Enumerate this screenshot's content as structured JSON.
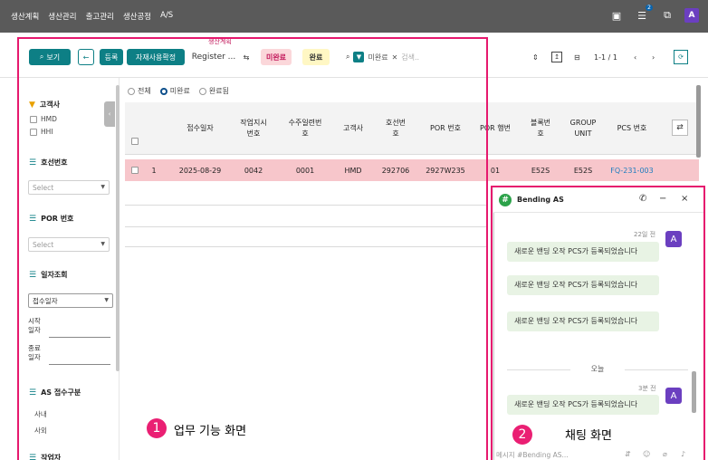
{
  "topbar": {
    "nav": [
      "생산계획",
      "생산관리",
      "출고관리",
      "생산공정",
      "A/S"
    ],
    "notif_count": "2",
    "user_initial": "A"
  },
  "toolbar": {
    "view_label": "보기",
    "back_label": "←",
    "register_label": "등록",
    "material_label": "자재사용확정",
    "breadcrumb_small": "생산계획",
    "register_dropdown": "Register ...",
    "status_incomplete": "미완료",
    "status_complete": "완료",
    "filter_tag": "미완료",
    "search_placeholder": "검색..",
    "pagination": "1-1 / 1"
  },
  "filters": {
    "customer": {
      "title": "고객사",
      "options": [
        "HMD",
        "HHI"
      ]
    },
    "hull": {
      "title": "호선번호",
      "placeholder": "Select"
    },
    "por": {
      "title": "POR 번호",
      "placeholder": "Select"
    },
    "date": {
      "title": "일자조회",
      "type_value": "접수일자",
      "start_label_1": "시작",
      "start_label_2": "일자",
      "end_label_1": "종료",
      "end_label_2": "일자"
    },
    "as_type": {
      "title": "AS 접수구분",
      "options": [
        "사내",
        "사외"
      ]
    },
    "worker": {
      "title": "작업자"
    }
  },
  "radios": {
    "all": "전체",
    "incomplete": "미완료",
    "done": "완료됨"
  },
  "grid": {
    "headers": [
      "접수일자",
      "작업지시\n번호",
      "수주일련번\n호",
      "고객사",
      "호선번\n호",
      "POR 번호",
      "POR 행번",
      "블록번\n호",
      "GROUP\nUNIT",
      "PCS 번호"
    ],
    "row": [
      "1",
      "2025-08-29",
      "0042",
      "0001",
      "HMD",
      "292706",
      "2927W235",
      "01",
      "E52S",
      "E52S",
      "FQ-231-003"
    ]
  },
  "annotations": {
    "work_badge": "1",
    "work_label": "업무 기능 화면",
    "chat_badge": "2",
    "chat_label": "채팅 화면"
  },
  "chat": {
    "title": "Bending AS",
    "time_old": "22일 전",
    "message": "새로운 밴딩 오작 PCS가 등록되었습니다",
    "day_label": "오늘",
    "time_new": "3분 전",
    "avatar_initial": "A",
    "input_placeholder": "메시지 #Bending AS..."
  }
}
